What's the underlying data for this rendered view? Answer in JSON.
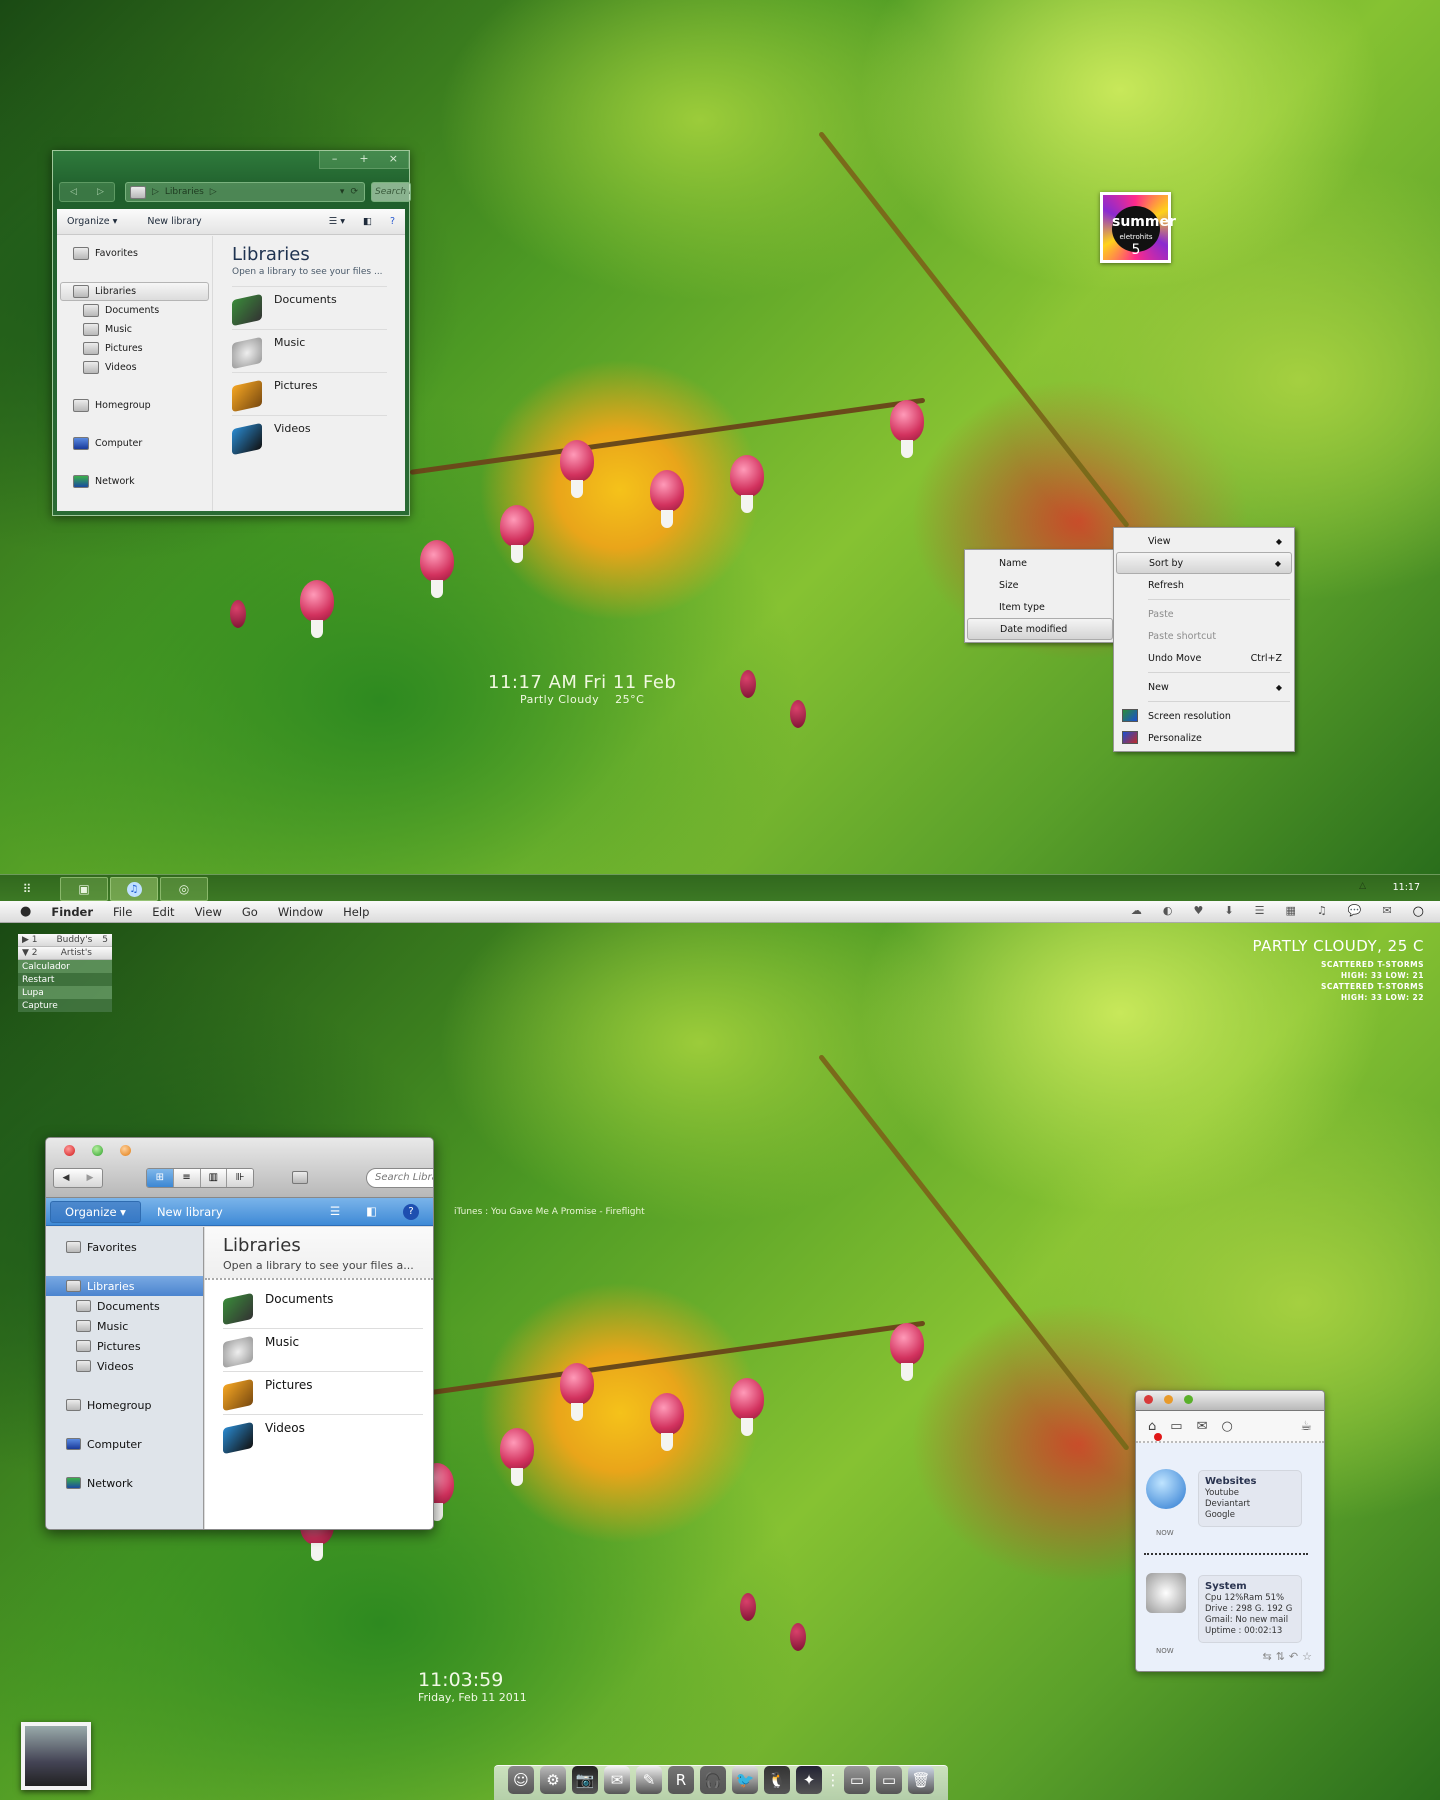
{
  "top_desktop": {
    "explorer": {
      "caption_buttons": [
        "–",
        "+",
        "×"
      ],
      "address": {
        "path": "Libraries",
        "search_placeholder": "Search Li"
      },
      "toolbar": {
        "organize": "Organize ▾",
        "new_library": "New library"
      },
      "nav": [
        {
          "label": "Favorites",
          "icon": "favorites-folder-icon",
          "level": 0
        },
        {
          "label": "Libraries",
          "icon": "libraries-icon",
          "level": 0,
          "selected": true
        },
        {
          "label": "Documents",
          "icon": "documents-icon",
          "level": 1
        },
        {
          "label": "Music",
          "icon": "music-icon",
          "level": 1
        },
        {
          "label": "Pictures",
          "icon": "pictures-icon",
          "level": 1
        },
        {
          "label": "Videos",
          "icon": "videos-icon",
          "level": 1
        },
        {
          "label": "Homegroup",
          "icon": "homegroup-icon",
          "level": 0
        },
        {
          "label": "Computer",
          "icon": "computer-icon",
          "level": 0
        },
        {
          "label": "Network",
          "icon": "network-icon",
          "level": 0
        }
      ],
      "content": {
        "title": "Libraries",
        "subtitle": "Open a library to see your files ...",
        "items": [
          "Documents",
          "Music",
          "Pictures",
          "Videos"
        ]
      }
    },
    "sort_submenu": [
      "Name",
      "Size",
      "Item type",
      "Date modified"
    ],
    "sort_submenu_highlighted": "Date modified",
    "context_menu": {
      "items": [
        {
          "label": "View",
          "arrow": true
        },
        {
          "label": "Sort by",
          "arrow": true,
          "highlighted": true
        },
        {
          "label": "Refresh"
        },
        {
          "sep": true
        },
        {
          "label": "Paste",
          "disabled": true
        },
        {
          "label": "Paste shortcut",
          "disabled": true
        },
        {
          "label": "Undo Move",
          "shortcut": "Ctrl+Z"
        },
        {
          "sep": true
        },
        {
          "label": "New",
          "arrow": true
        },
        {
          "sep": true
        },
        {
          "label": "Screen resolution",
          "icon": "screen-resolution-icon"
        },
        {
          "label": "Personalize",
          "icon": "personalize-icon"
        }
      ]
    },
    "clock_widget": {
      "time": "11:17 AM Fri 11 Feb",
      "weather": "Partly Cloudy",
      "temp": "25°C"
    },
    "album_art": {
      "title": "summer",
      "subtitle": "eletrohits",
      "number": "5"
    },
    "taskbar": {
      "start_glyph": "⠿",
      "buttons": [
        {
          "icon": "explorer-icon",
          "glyph": "▣"
        },
        {
          "icon": "itunes-icon",
          "glyph": "♫"
        },
        {
          "icon": "chrome-icon",
          "glyph": "◎"
        }
      ],
      "tray_arrow": "△",
      "clock": "11:17"
    }
  },
  "bottom_desktop": {
    "menubar": {
      "apple": "",
      "menus": [
        "Finder",
        "File",
        "Edit",
        "View",
        "Go",
        "Window",
        "Help"
      ],
      "status_icons": [
        {
          "name": "cloud-icon",
          "glyph": "☁"
        },
        {
          "name": "disk-icon",
          "glyph": "◐"
        },
        {
          "name": "heart-icon",
          "glyph": "♥"
        },
        {
          "name": "download-icon",
          "glyph": "⬇"
        },
        {
          "name": "rss-icon",
          "glyph": "☰"
        },
        {
          "name": "grid-icon",
          "glyph": "▦"
        },
        {
          "name": "music-note-icon",
          "glyph": "♫"
        },
        {
          "name": "chat-icon",
          "glyph": "💬"
        },
        {
          "name": "mail-icon",
          "glyph": "✉"
        },
        {
          "name": "spotlight-icon",
          "glyph": "○"
        }
      ]
    },
    "launcher": {
      "rows": [
        {
          "arrow": "▶",
          "num": "1",
          "label": "Buddy's",
          "count": "5"
        },
        {
          "arrow": "▼",
          "num": "2",
          "label": "Artist's",
          "count": ""
        }
      ],
      "items": [
        "Calculador",
        "Restart",
        "Lupa",
        "Capture"
      ]
    },
    "weather": {
      "current": "PARTLY CLOUDY, 25 C",
      "forecast": [
        {
          "cond": "SCATTERED T-STORMS",
          "range": "HIGH: 33 LOW: 21"
        },
        {
          "cond": "SCATTERED T-STORMS",
          "range": "HIGH: 33 LOW: 22"
        }
      ]
    },
    "finder": {
      "search_placeholder": "Search Libraries",
      "views": [
        "⊞",
        "≡",
        "▥",
        "⊪"
      ],
      "toolbar": {
        "organize": "Organize ▾",
        "new_library": "New library"
      },
      "nav": [
        {
          "label": "Favorites",
          "level": 0
        },
        {
          "label": "Libraries",
          "level": 0,
          "selected": true
        },
        {
          "label": "Documents",
          "level": 1
        },
        {
          "label": "Music",
          "level": 1
        },
        {
          "label": "Pictures",
          "level": 1
        },
        {
          "label": "Videos",
          "level": 1
        },
        {
          "label": "Homegroup",
          "level": 0
        },
        {
          "label": "Computer",
          "level": 0
        },
        {
          "label": "Network",
          "level": 0
        }
      ],
      "content": {
        "title": "Libraries",
        "subtitle": "Open a library to see your files a...",
        "items": [
          "Documents",
          "Music",
          "Pictures",
          "Videos"
        ]
      }
    },
    "itunes_now_playing": "iTunes : You Gave Me A Promise - Fireflight",
    "clock": {
      "time": "11:03:59",
      "date": "Friday, Feb 11 2011"
    },
    "notifier": {
      "tabs": [
        {
          "name": "home-icon",
          "glyph": "⌂"
        },
        {
          "name": "chat-icon",
          "glyph": "▭"
        },
        {
          "name": "mail-icon",
          "glyph": "✉"
        },
        {
          "name": "search-icon",
          "glyph": "○"
        },
        {
          "name": "coffee-icon",
          "glyph": "☕"
        }
      ],
      "cards": [
        {
          "title": "Websites",
          "lines": [
            "Youtube",
            "Deviantart",
            "Google"
          ],
          "time": "NOW"
        },
        {
          "title": "System",
          "lines": [
            "Cpu 12%Ram 51%",
            "Drive :  298 G. 192 G",
            "Gmail: No new mail",
            "Uptime :  00:02:13"
          ],
          "time": "NOW"
        }
      ],
      "actions": [
        "reply",
        "retweet",
        "undo",
        "star"
      ]
    },
    "dock": [
      {
        "name": "finder-icon",
        "glyph": "☺"
      },
      {
        "name": "system-preferences-icon",
        "glyph": "⚙"
      },
      {
        "name": "camera-icon",
        "glyph": "📷"
      },
      {
        "name": "mail-icon",
        "glyph": "✉"
      },
      {
        "name": "textedit-icon",
        "glyph": "✎"
      },
      {
        "name": "rockstar-icon",
        "glyph": "R"
      },
      {
        "name": "headphones-icon",
        "glyph": "🎧"
      },
      {
        "name": "twitter-icon",
        "glyph": "🐦"
      },
      {
        "name": "penguin-icon",
        "glyph": "🐧"
      },
      {
        "name": "safari-icon",
        "glyph": "✦"
      },
      {
        "name": "separator",
        "glyph": "⋮"
      },
      {
        "name": "applications-folder-icon",
        "glyph": "▭"
      },
      {
        "name": "documents-folder-icon",
        "glyph": "▭"
      },
      {
        "name": "trash-icon",
        "glyph": "🗑"
      }
    ]
  }
}
